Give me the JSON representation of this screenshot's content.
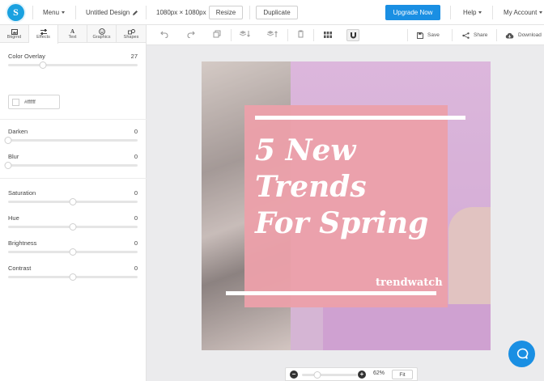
{
  "topbar": {
    "logo_letter": "S",
    "menu_label": "Menu",
    "design_name": "Untitled Design",
    "dimensions": "1080px × 1080px",
    "resize_label": "Resize",
    "duplicate_label": "Duplicate",
    "upgrade_label": "Upgrade Now",
    "help_label": "Help",
    "account_label": "My Account"
  },
  "sidebar": {
    "tabs": [
      {
        "label": "Bkgrnd",
        "icon": "image-icon"
      },
      {
        "label": "Effects",
        "icon": "sliders-icon"
      },
      {
        "label": "Text",
        "icon": "text-icon"
      },
      {
        "label": "Graphics",
        "icon": "smiley-icon"
      },
      {
        "label": "Shapes",
        "icon": "shapes-icon"
      }
    ],
    "active_tab": "Effects",
    "color_overlay": {
      "label": "Color Overlay",
      "value": "27",
      "fraction": 0.27,
      "hex": "#ffffff"
    },
    "darken": {
      "label": "Darken",
      "value": "0",
      "fraction": 0.0
    },
    "blur": {
      "label": "Blur",
      "value": "0",
      "fraction": 0.0
    },
    "saturation": {
      "label": "Saturation",
      "value": "0",
      "fraction": 0.5
    },
    "hue": {
      "label": "Hue",
      "value": "0",
      "fraction": 0.5
    },
    "brightness": {
      "label": "Brightness",
      "value": "0",
      "fraction": 0.5
    },
    "contrast": {
      "label": "Contrast",
      "value": "0",
      "fraction": 0.5
    }
  },
  "toolbar": {
    "save_label": "Save",
    "share_label": "Share",
    "download_label": "Download"
  },
  "design": {
    "headline": [
      "5 New",
      "Trends",
      "For Spring"
    ],
    "brand": "trendwatch",
    "box_color": "#eca0aa"
  },
  "zoom": {
    "percent": "62%",
    "fraction": 0.28,
    "fit_label": "Fit"
  },
  "colors": {
    "accent": "#1a8fe3",
    "logo": "#1aa1e0"
  }
}
